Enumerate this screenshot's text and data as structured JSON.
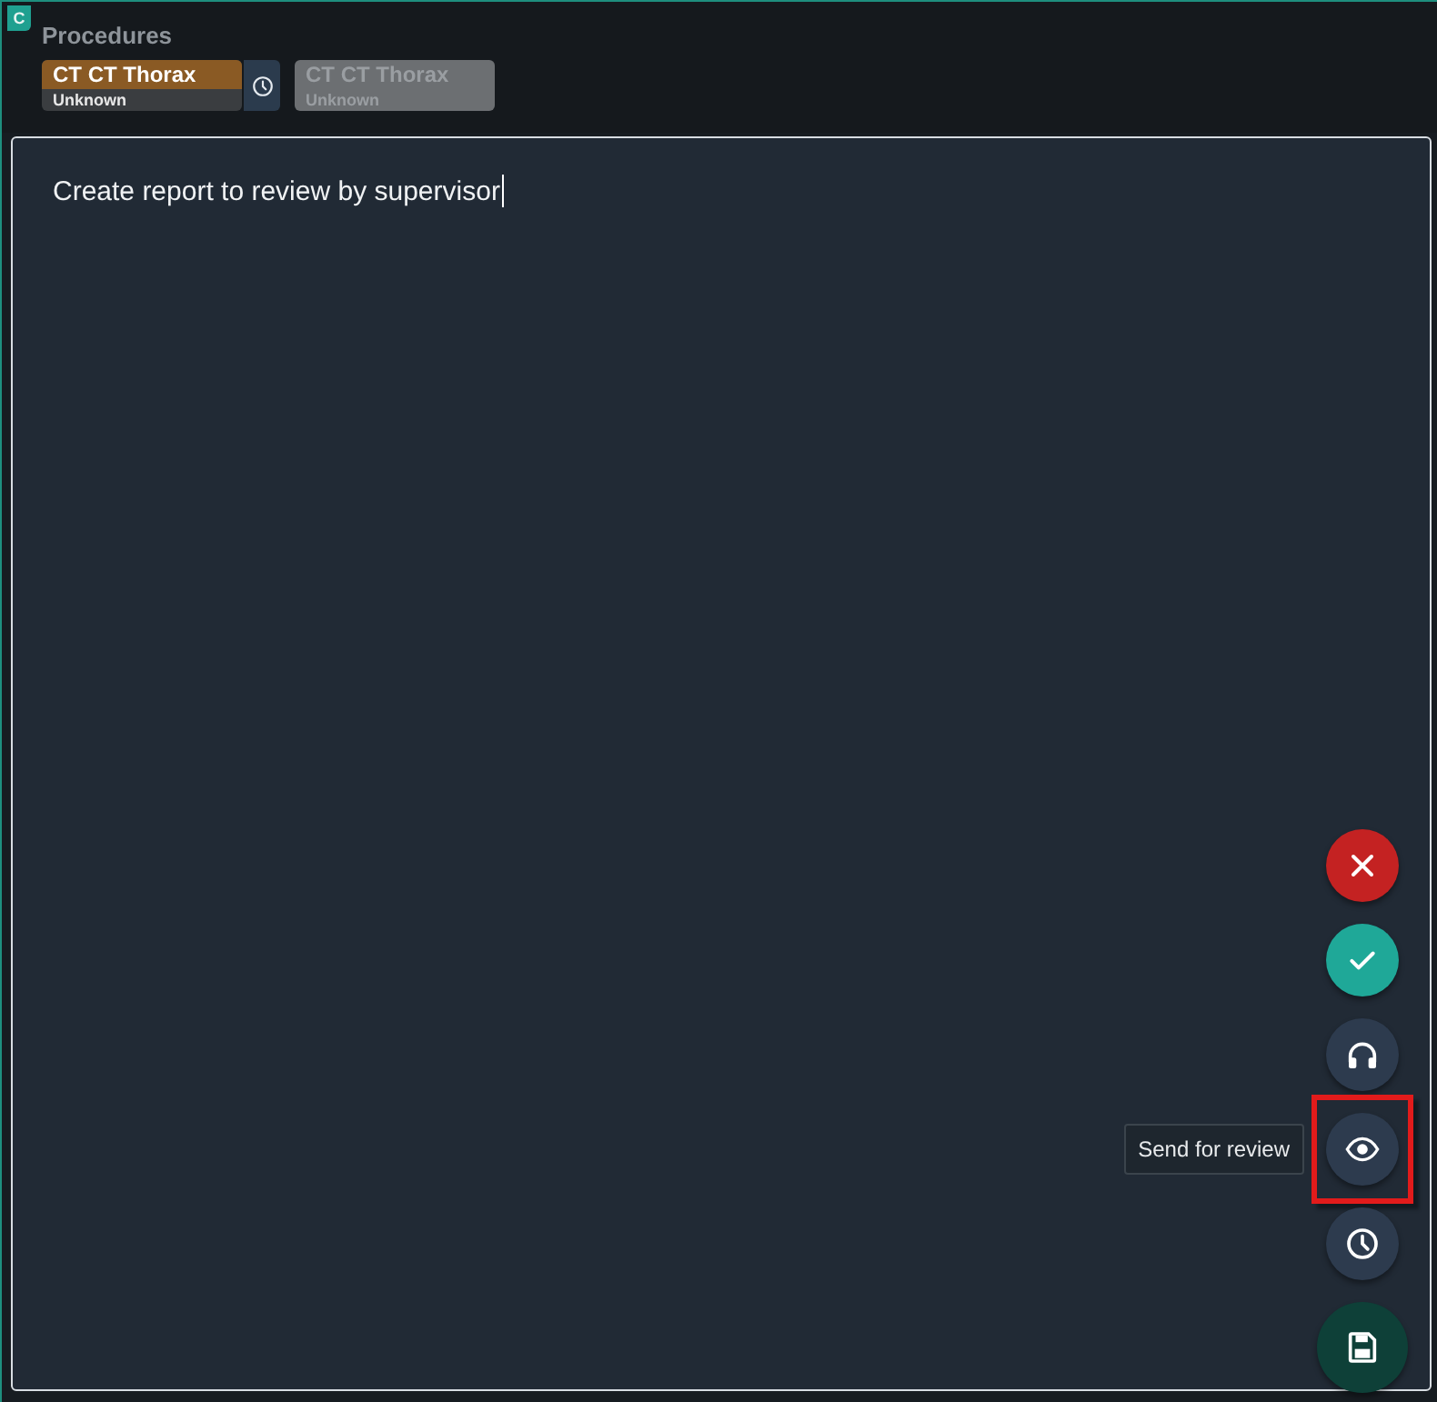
{
  "section_badge": "C",
  "title": "Procedures",
  "procedures": [
    {
      "name": "CT CT Thorax",
      "status": "Unknown",
      "selected": true,
      "has_time_button": true
    },
    {
      "name": "CT CT Thorax",
      "status": "Unknown",
      "selected": false,
      "has_time_button": false
    }
  ],
  "editor": {
    "value": "Create report to review by supervisor"
  },
  "actions": [
    {
      "kind": "cancel",
      "highlighted": false
    },
    {
      "kind": "confirm",
      "highlighted": false
    },
    {
      "kind": "dictate",
      "highlighted": false
    },
    {
      "kind": "review",
      "highlighted": true,
      "tooltip": "Send for review"
    },
    {
      "kind": "history",
      "highlighted": false
    },
    {
      "kind": "save",
      "highlighted": false
    }
  ]
}
